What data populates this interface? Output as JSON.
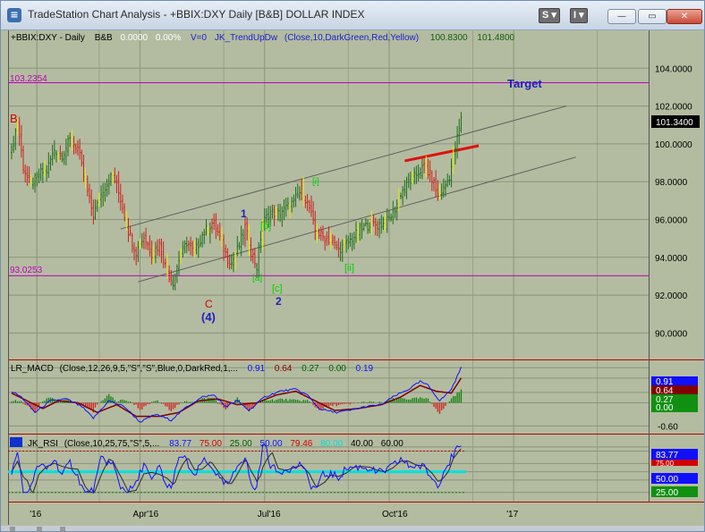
{
  "window": {
    "title": "TradeStation Chart Analysis - +BBIX:DXY Daily [B&B] DOLLAR INDEX",
    "s_button": "S ▾",
    "i_button": "I ▾",
    "minimize": "—",
    "maximize": "▭",
    "close": "✕"
  },
  "price_header": {
    "symbol": "+BBIX:DXY - Daily",
    "bb": "B&B",
    "v1": "0.0000",
    "v2": "0.00%",
    "vol": "V=0",
    "indicator": "JK_TrendUpDw",
    "params": "(Close,10,DarkGreen,Red,Yellow)",
    "val1": "100.8300",
    "val2": "101.4800"
  },
  "macd_header": {
    "name": "LR_MACD",
    "params": "(Close,12,26,9,5,\"S\",\"S\",Blue,0,DarkRed,1,...",
    "v1": "0.91",
    "v2": "0.64",
    "v3": "0.27",
    "v4": "0.00",
    "v5": "0.19"
  },
  "rsi_header": {
    "name": "JK_RSI",
    "params": "(Close,10,25,75,\"S\",5,...",
    "v1": "83.77",
    "v2": "75.00",
    "v3": "25.00",
    "v4": "50.00",
    "v5": "79.46",
    "v6": "80.00",
    "v7": "40.00",
    "v8": "60.00"
  },
  "annotations": {
    "target": "Target",
    "b": "B",
    "c": "C",
    "four": "(4)",
    "one": "1",
    "two": "2",
    "a": "[a]",
    "b_small": "[b]",
    "c_small": "[c]",
    "i": "[i]",
    "ii": "[ii]",
    "level_high": "103.2354",
    "level_low": "93.0253"
  },
  "price_axis_last": "101.3400",
  "macd_axis_values": [
    "0.91",
    "0.64",
    "0.27",
    "0.00"
  ],
  "rsi_axis_values": [
    "83.77",
    "75.00",
    "50.00",
    "25.00"
  ],
  "colors": {
    "panel_bg": "#b3bca0",
    "up_bar": "#1e6e1e",
    "down_bar": "#d02020",
    "neutral_bar": "#e8e800",
    "level_line": "#c000c0",
    "border_red": "#c00000",
    "macd_blue": "#1010ff",
    "macd_red": "#800000",
    "wave_blue": "#2020c0",
    "wave_green": "#00d000"
  },
  "chart_data": {
    "type": "candlestick",
    "title": "+BBIX:DXY Daily [B&B] DOLLAR INDEX",
    "price_ylim": [
      88.6,
      106.0
    ],
    "price_ticks": [
      90,
      92,
      94,
      96,
      98,
      100,
      102,
      104
    ],
    "x_ticks": [
      {
        "label": "'16",
        "idx": 13
      },
      {
        "label": "Apr'16",
        "idx": 66
      },
      {
        "label": "Jul'16",
        "idx": 130
      },
      {
        "label": "Oct'16",
        "idx": 194
      },
      {
        "label": "'17",
        "idx": 258
      }
    ],
    "last_price": 101.34,
    "horizontal_levels": [
      103.2354,
      93.0253
    ],
    "price_keypoints": [
      [
        0,
        99.6
      ],
      [
        3,
        101.2
      ],
      [
        6,
        98.8
      ],
      [
        10,
        97.8
      ],
      [
        14,
        98.4
      ],
      [
        18,
        98.6
      ],
      [
        22,
        99.7
      ],
      [
        26,
        99.4
      ],
      [
        30,
        100.2
      ],
      [
        34,
        99.8
      ],
      [
        37,
        98.3
      ],
      [
        42,
        96.2
      ],
      [
        47,
        97.6
      ],
      [
        52,
        98.4
      ],
      [
        56,
        97.1
      ],
      [
        60,
        95.4
      ],
      [
        64,
        94.3
      ],
      [
        68,
        95.1
      ],
      [
        72,
        94.2
      ],
      [
        76,
        94.7
      ],
      [
        80,
        93.2
      ],
      [
        83,
        92.7
      ],
      [
        86,
        93.9
      ],
      [
        90,
        94.8
      ],
      [
        94,
        94.2
      ],
      [
        98,
        95.2
      ],
      [
        103,
        95.8
      ],
      [
        106,
        95.3
      ],
      [
        110,
        94.2
      ],
      [
        113,
        93.7
      ],
      [
        117,
        94.6
      ],
      [
        120,
        95.6
      ],
      [
        123,
        94.3
      ],
      [
        126,
        93.5
      ],
      [
        129,
        95.8
      ],
      [
        133,
        96.4
      ],
      [
        137,
        96.3
      ],
      [
        141,
        96.6
      ],
      [
        145,
        96.9
      ],
      [
        149,
        97.6
      ],
      [
        153,
        96.6
      ],
      [
        156,
        95.4
      ],
      [
        160,
        95.1
      ],
      [
        164,
        94.9
      ],
      [
        168,
        94.4
      ],
      [
        172,
        94.7
      ],
      [
        176,
        95.1
      ],
      [
        180,
        95.5
      ],
      [
        184,
        95.8
      ],
      [
        188,
        95.7
      ],
      [
        192,
        95.8
      ],
      [
        196,
        96.3
      ],
      [
        200,
        97.4
      ],
      [
        204,
        97.9
      ],
      [
        208,
        98.4
      ],
      [
        212,
        98.8
      ],
      [
        216,
        98.2
      ],
      [
        219,
        97.3
      ],
      [
        222,
        97.6
      ],
      [
        225,
        98.3
      ],
      [
        228,
        99.8
      ],
      [
        231,
        101.3
      ]
    ],
    "wave_labels": [
      "B",
      "C",
      "(4)",
      "1",
      "2",
      "[a]",
      "[b]",
      "[c]",
      "[i]",
      "[ii]",
      "Target"
    ],
    "trend_channel_upper": [
      [
        56,
        95.5
      ],
      [
        285,
        102.0
      ]
    ],
    "trend_channel_lower": [
      [
        65,
        92.7
      ],
      [
        290,
        99.3
      ]
    ],
    "red_trendline": [
      [
        202,
        99.1
      ],
      [
        240,
        99.9
      ]
    ],
    "macd": {
      "ylim": [
        -0.8,
        1.1
      ],
      "ticks": [
        -0.6,
        0.0,
        0.27,
        0.64,
        0.91
      ],
      "macd_keypoints": [
        [
          0,
          0.3
        ],
        [
          5,
          0.15
        ],
        [
          12,
          -0.25
        ],
        [
          20,
          0.05
        ],
        [
          28,
          0.1
        ],
        [
          36,
          -0.1
        ],
        [
          42,
          -0.4
        ],
        [
          50,
          0.05
        ],
        [
          58,
          -0.1
        ],
        [
          66,
          -0.5
        ],
        [
          74,
          -0.3
        ],
        [
          82,
          -0.45
        ],
        [
          90,
          -0.1
        ],
        [
          98,
          0.15
        ],
        [
          104,
          0.2
        ],
        [
          110,
          -0.1
        ],
        [
          116,
          0.05
        ],
        [
          122,
          -0.2
        ],
        [
          130,
          0.15
        ],
        [
          138,
          0.3
        ],
        [
          146,
          0.35
        ],
        [
          152,
          0.2
        ],
        [
          158,
          -0.15
        ],
        [
          166,
          -0.25
        ],
        [
          174,
          -0.2
        ],
        [
          182,
          -0.1
        ],
        [
          190,
          -0.05
        ],
        [
          196,
          0.15
        ],
        [
          204,
          0.35
        ],
        [
          210,
          0.55
        ],
        [
          214,
          0.45
        ],
        [
          220,
          0.05
        ],
        [
          226,
          0.35
        ],
        [
          231,
          0.91
        ]
      ],
      "signal_keypoints": [
        [
          0,
          0.25
        ],
        [
          8,
          0.05
        ],
        [
          16,
          -0.15
        ],
        [
          24,
          0.05
        ],
        [
          34,
          0.0
        ],
        [
          44,
          -0.25
        ],
        [
          54,
          -0.05
        ],
        [
          64,
          -0.35
        ],
        [
          76,
          -0.35
        ],
        [
          86,
          -0.25
        ],
        [
          96,
          0.05
        ],
        [
          106,
          0.1
        ],
        [
          116,
          -0.05
        ],
        [
          126,
          0.0
        ],
        [
          136,
          0.2
        ],
        [
          146,
          0.3
        ],
        [
          156,
          0.05
        ],
        [
          166,
          -0.2
        ],
        [
          178,
          -0.15
        ],
        [
          190,
          -0.05
        ],
        [
          200,
          0.15
        ],
        [
          210,
          0.45
        ],
        [
          218,
          0.3
        ],
        [
          226,
          0.25
        ],
        [
          231,
          0.64
        ]
      ]
    },
    "rsi": {
      "ylim": [
        15,
        95
      ],
      "levels": [
        25,
        40,
        50,
        60,
        75,
        80
      ],
      "ticks": [
        25.0,
        50.0,
        75.0,
        83.77
      ]
    }
  }
}
